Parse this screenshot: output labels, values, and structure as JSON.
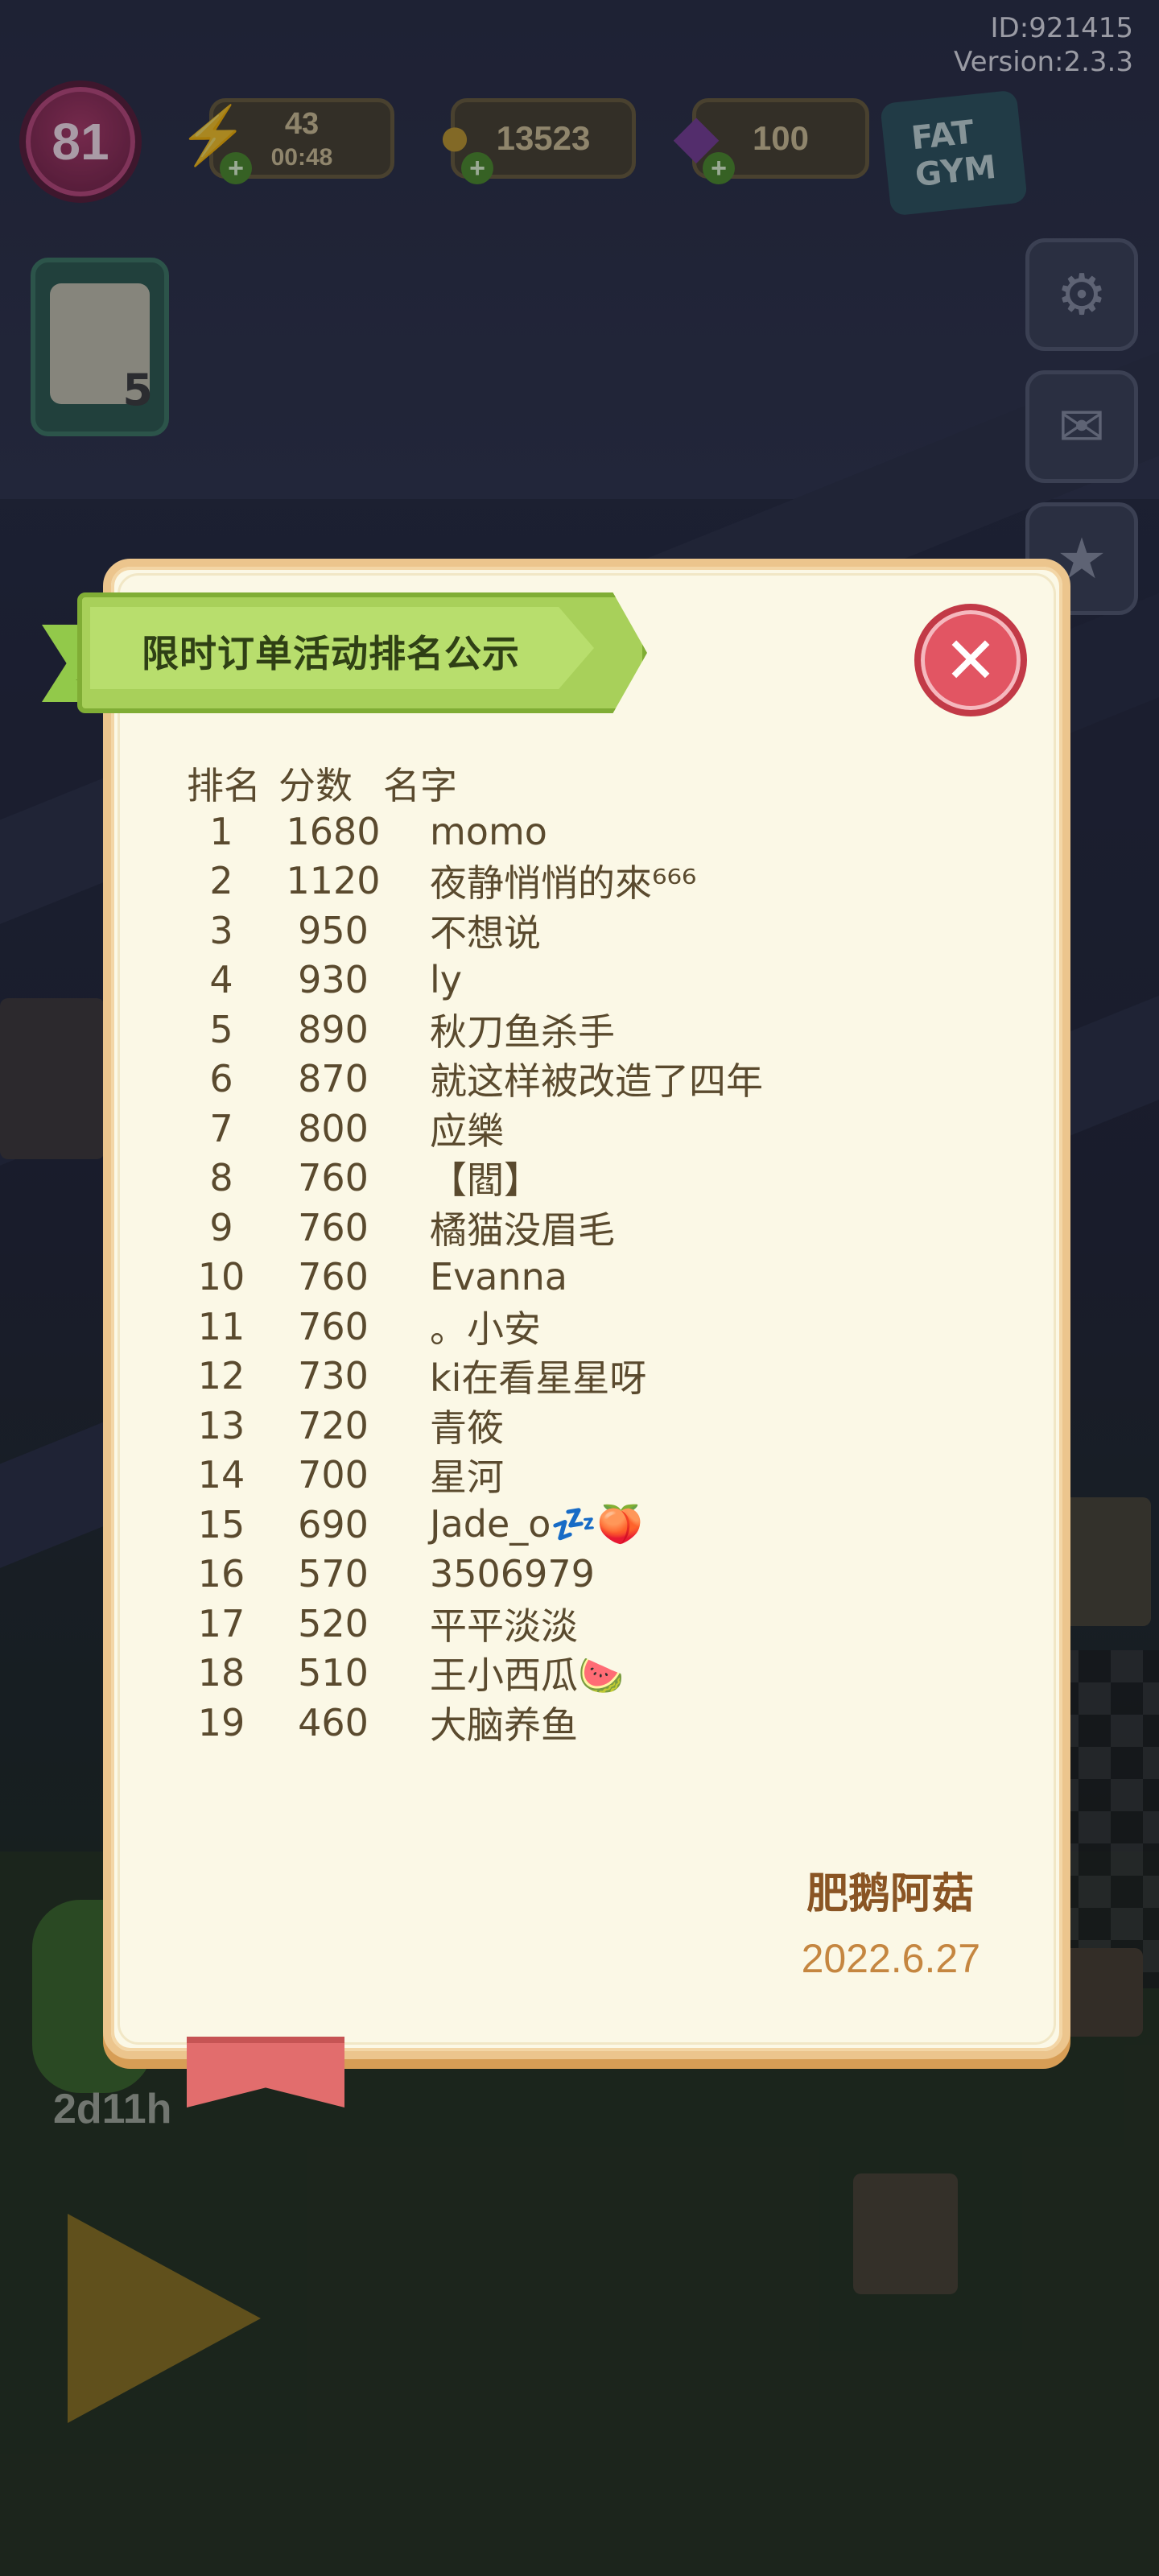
{
  "hud": {
    "id_text": "ID:921415",
    "version_text": "Version:2.3.3",
    "level": "81",
    "energy": {
      "value": "43",
      "timer": "00:48",
      "icon": "lightning-icon"
    },
    "coins": {
      "value": "13523",
      "icon": "coin-icon"
    },
    "gems": {
      "value": "100",
      "icon": "gem-icon"
    },
    "quest_count": "5",
    "bottom_timer": "2d11h"
  },
  "modal": {
    "title": "限时订单活动排名公示",
    "headers": {
      "rank": "排名",
      "score": "分数",
      "name": "名字"
    },
    "rows": [
      {
        "rank": "1",
        "score": "1680",
        "name": "momo"
      },
      {
        "rank": "2",
        "score": "1120",
        "name": "夜静悄悄的來⁶⁶⁶"
      },
      {
        "rank": "3",
        "score": "950",
        "name": "不想说"
      },
      {
        "rank": "4",
        "score": "930",
        "name": "ly"
      },
      {
        "rank": "5",
        "score": "890",
        "name": "秋刀鱼杀手"
      },
      {
        "rank": "6",
        "score": "870",
        "name": "就这样被改造了四年"
      },
      {
        "rank": "7",
        "score": "800",
        "name": "应樂"
      },
      {
        "rank": "8",
        "score": "760",
        "name": "【閻】"
      },
      {
        "rank": "9",
        "score": "760",
        "name": "橘猫没眉毛"
      },
      {
        "rank": "10",
        "score": "760",
        "name": "Evanna"
      },
      {
        "rank": "11",
        "score": "760",
        "name": "。小安"
      },
      {
        "rank": "12",
        "score": "730",
        "name": "ki在看星星呀"
      },
      {
        "rank": "13",
        "score": "720",
        "name": "青筱"
      },
      {
        "rank": "14",
        "score": "700",
        "name": "星河"
      },
      {
        "rank": "15",
        "score": "690",
        "name": "Jade_o💤🍑"
      },
      {
        "rank": "16",
        "score": "570",
        "name": "3506979"
      },
      {
        "rank": "17",
        "score": "520",
        "name": "平平淡淡"
      },
      {
        "rank": "18",
        "score": "510",
        "name": "王小西瓜🍉"
      },
      {
        "rank": "19",
        "score": "460",
        "name": "大脑养鱼"
      }
    ],
    "signature": "肥鹅阿菇",
    "date": "2022.6.27"
  },
  "colors": {
    "modal_bg": "#fbf8e6",
    "modal_border": "#ecc58d",
    "ribbon_green": "#a8d05a",
    "close_red": "#e25563",
    "text_brown": "#5a4a2e",
    "signature_brown": "#8a5524",
    "date_orange": "#c58640"
  }
}
